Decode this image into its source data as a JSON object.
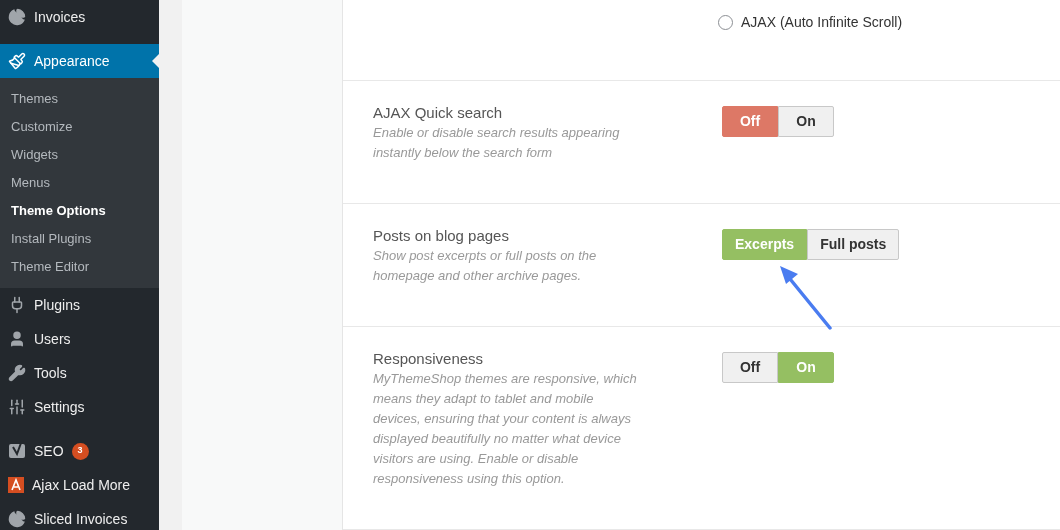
{
  "sidebar": {
    "items": [
      {
        "label": "Invoices",
        "selected": false
      },
      {
        "label": "Appearance",
        "selected": true,
        "children": [
          {
            "label": "Themes",
            "selected": false
          },
          {
            "label": "Customize",
            "selected": false
          },
          {
            "label": "Widgets",
            "selected": false
          },
          {
            "label": "Menus",
            "selected": false
          },
          {
            "label": "Theme Options",
            "selected": true
          },
          {
            "label": "Install Plugins",
            "selected": false
          },
          {
            "label": "Theme Editor",
            "selected": false
          }
        ]
      },
      {
        "label": "Plugins",
        "selected": false
      },
      {
        "label": "Users",
        "selected": false
      },
      {
        "label": "Tools",
        "selected": false
      },
      {
        "label": "Settings",
        "selected": false
      },
      {
        "label": "SEO",
        "selected": false,
        "badge": "3"
      },
      {
        "label": "Ajax Load More",
        "selected": false
      },
      {
        "label": "Sliced Invoices",
        "selected": false
      }
    ]
  },
  "radio_options": [
    {
      "label": "AJAX (Auto Infinite Scroll)",
      "selected": false
    }
  ],
  "settings": [
    {
      "title": "AJAX Quick search",
      "description": "Enable or disable search results appearing instantly below the search form",
      "color": "#dd7866",
      "options": [
        {
          "label": "Off",
          "selected": true
        },
        {
          "label": "On",
          "selected": false
        }
      ]
    },
    {
      "title": "Posts on blog pages",
      "description": "Show post excerpts or full posts on the homepage and other archive pages.",
      "color": "#95bf62",
      "options": [
        {
          "label": "Excerpts",
          "selected": true
        },
        {
          "label": "Full posts",
          "selected": false
        }
      ]
    },
    {
      "title": "Responsiveness",
      "description": "MyThemeShop themes are responsive, which means they adapt to tablet and mobile devices, ensuring that your content is always displayed beautifully no matter what device visitors are using. Enable or disable responsiveness using this option.",
      "color": "#95bf62",
      "options": [
        {
          "label": "Off",
          "selected": false
        },
        {
          "label": "On",
          "selected": true
        }
      ]
    }
  ]
}
